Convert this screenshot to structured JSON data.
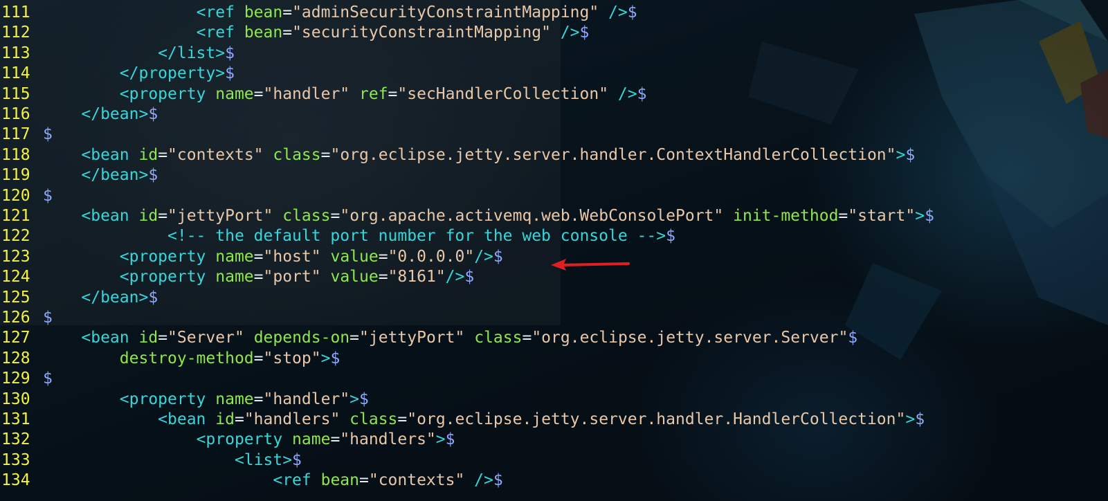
{
  "theme": {
    "line_number_color": "#f4f43a",
    "tag_color": "#36d7d9",
    "attribute_color": "#8ee84c",
    "string_color": "#e8c8a8",
    "eol_marker_color": "#8fa8ff",
    "annotation_arrow_color": "#e02020"
  },
  "annotation": {
    "icon": "red-arrow-icon",
    "points_to_line": "123"
  },
  "lines": [
    {
      "no": "111",
      "indent": 16,
      "tokens": [
        [
          "tag",
          "<ref "
        ],
        [
          "attr",
          "bean"
        ],
        [
          "eq",
          "="
        ],
        [
          "str",
          "\"adminSecurityConstraintMapping\""
        ],
        [
          "tag",
          " />"
        ],
        [
          "eol",
          "$"
        ]
      ]
    },
    {
      "no": "112",
      "indent": 16,
      "tokens": [
        [
          "tag",
          "<ref "
        ],
        [
          "attr",
          "bean"
        ],
        [
          "eq",
          "="
        ],
        [
          "str",
          "\"securityConstraintMapping\""
        ],
        [
          "tag",
          " />"
        ],
        [
          "eol",
          "$"
        ]
      ]
    },
    {
      "no": "113",
      "indent": 12,
      "tokens": [
        [
          "tag",
          "</list>"
        ],
        [
          "eol",
          "$"
        ]
      ]
    },
    {
      "no": "114",
      "indent": 8,
      "tokens": [
        [
          "tag",
          "</property>"
        ],
        [
          "eol",
          "$"
        ]
      ]
    },
    {
      "no": "115",
      "indent": 8,
      "tokens": [
        [
          "tag",
          "<property "
        ],
        [
          "attr",
          "name"
        ],
        [
          "eq",
          "="
        ],
        [
          "str",
          "\"handler\""
        ],
        [
          "txt",
          " "
        ],
        [
          "attr",
          "ref"
        ],
        [
          "eq",
          "="
        ],
        [
          "str",
          "\"secHandlerCollection\""
        ],
        [
          "tag",
          " />"
        ],
        [
          "eol",
          "$"
        ]
      ]
    },
    {
      "no": "116",
      "indent": 4,
      "tokens": [
        [
          "tag",
          "</bean>"
        ],
        [
          "eol",
          "$"
        ]
      ]
    },
    {
      "no": "117",
      "indent": 0,
      "tokens": [
        [
          "eol",
          "$"
        ]
      ]
    },
    {
      "no": "118",
      "indent": 4,
      "tokens": [
        [
          "tag",
          "<bean "
        ],
        [
          "attr",
          "id"
        ],
        [
          "eq",
          "="
        ],
        [
          "str",
          "\"contexts\""
        ],
        [
          "txt",
          " "
        ],
        [
          "attr",
          "class"
        ],
        [
          "eq",
          "="
        ],
        [
          "str",
          "\"org.eclipse.jetty.server.handler.ContextHandlerCollection\""
        ],
        [
          "tag",
          ">"
        ],
        [
          "eol",
          "$"
        ]
      ]
    },
    {
      "no": "119",
      "indent": 4,
      "tokens": [
        [
          "tag",
          "</bean>"
        ],
        [
          "eol",
          "$"
        ]
      ]
    },
    {
      "no": "120",
      "indent": 0,
      "tokens": [
        [
          "eol",
          "$"
        ]
      ]
    },
    {
      "no": "121",
      "indent": 4,
      "tokens": [
        [
          "tag",
          "<bean "
        ],
        [
          "attr",
          "id"
        ],
        [
          "eq",
          "="
        ],
        [
          "str",
          "\"jettyPort\""
        ],
        [
          "txt",
          " "
        ],
        [
          "attr",
          "class"
        ],
        [
          "eq",
          "="
        ],
        [
          "str",
          "\"org.apache.activemq.web.WebConsolePort\""
        ],
        [
          "txt",
          " "
        ],
        [
          "attr",
          "init-method"
        ],
        [
          "eq",
          "="
        ],
        [
          "str",
          "\"start\""
        ],
        [
          "tag",
          ">"
        ],
        [
          "eol",
          "$"
        ]
      ]
    },
    {
      "no": "122",
      "indent": 13,
      "tokens": [
        [
          "com",
          "<!-- the default port number for the web console -->"
        ],
        [
          "eol",
          "$"
        ]
      ]
    },
    {
      "no": "123",
      "indent": 8,
      "tokens": [
        [
          "tag",
          "<property "
        ],
        [
          "attr",
          "name"
        ],
        [
          "eq",
          "="
        ],
        [
          "str",
          "\"host\""
        ],
        [
          "txt",
          " "
        ],
        [
          "attr",
          "value"
        ],
        [
          "eq",
          "="
        ],
        [
          "str",
          "\"0.0.0.0\""
        ],
        [
          "tag",
          "/>"
        ],
        [
          "eol",
          "$"
        ]
      ]
    },
    {
      "no": "124",
      "indent": 8,
      "tokens": [
        [
          "tag",
          "<property "
        ],
        [
          "attr",
          "name"
        ],
        [
          "eq",
          "="
        ],
        [
          "str",
          "\"port\""
        ],
        [
          "txt",
          " "
        ],
        [
          "attr",
          "value"
        ],
        [
          "eq",
          "="
        ],
        [
          "str",
          "\"8161\""
        ],
        [
          "tag",
          "/>"
        ],
        [
          "eol",
          "$"
        ]
      ]
    },
    {
      "no": "125",
      "indent": 4,
      "tokens": [
        [
          "tag",
          "</bean>"
        ],
        [
          "eol",
          "$"
        ]
      ]
    },
    {
      "no": "126",
      "indent": 0,
      "tokens": [
        [
          "eol",
          "$"
        ]
      ]
    },
    {
      "no": "127",
      "indent": 4,
      "tokens": [
        [
          "tag",
          "<bean "
        ],
        [
          "attr",
          "id"
        ],
        [
          "eq",
          "="
        ],
        [
          "str",
          "\"Server\""
        ],
        [
          "txt",
          " "
        ],
        [
          "attr",
          "depends-on"
        ],
        [
          "eq",
          "="
        ],
        [
          "str",
          "\"jettyPort\""
        ],
        [
          "txt",
          " "
        ],
        [
          "attr",
          "class"
        ],
        [
          "eq",
          "="
        ],
        [
          "str",
          "\"org.eclipse.jetty.server.Server\""
        ],
        [
          "eol",
          "$"
        ]
      ]
    },
    {
      "no": "128",
      "indent": 8,
      "tokens": [
        [
          "attr",
          "destroy-method"
        ],
        [
          "eq",
          "="
        ],
        [
          "str",
          "\"stop\""
        ],
        [
          "tag",
          ">"
        ],
        [
          "eol",
          "$"
        ]
      ]
    },
    {
      "no": "129",
      "indent": 0,
      "tokens": [
        [
          "eol",
          "$"
        ]
      ]
    },
    {
      "no": "130",
      "indent": 8,
      "tokens": [
        [
          "tag",
          "<property "
        ],
        [
          "attr",
          "name"
        ],
        [
          "eq",
          "="
        ],
        [
          "str",
          "\"handler\""
        ],
        [
          "tag",
          ">"
        ],
        [
          "eol",
          "$"
        ]
      ]
    },
    {
      "no": "131",
      "indent": 12,
      "tokens": [
        [
          "tag",
          "<bean "
        ],
        [
          "attr",
          "id"
        ],
        [
          "eq",
          "="
        ],
        [
          "str",
          "\"handlers\""
        ],
        [
          "txt",
          " "
        ],
        [
          "attr",
          "class"
        ],
        [
          "eq",
          "="
        ],
        [
          "str",
          "\"org.eclipse.jetty.server.handler.HandlerCollection\""
        ],
        [
          "tag",
          ">"
        ],
        [
          "eol",
          "$"
        ]
      ]
    },
    {
      "no": "132",
      "indent": 16,
      "tokens": [
        [
          "tag",
          "<property "
        ],
        [
          "attr",
          "name"
        ],
        [
          "eq",
          "="
        ],
        [
          "str",
          "\"handlers\""
        ],
        [
          "tag",
          ">"
        ],
        [
          "eol",
          "$"
        ]
      ]
    },
    {
      "no": "133",
      "indent": 20,
      "tokens": [
        [
          "tag",
          "<list>"
        ],
        [
          "eol",
          "$"
        ]
      ]
    },
    {
      "no": "134",
      "indent": 24,
      "tokens": [
        [
          "tag",
          "<ref "
        ],
        [
          "attr",
          "bean"
        ],
        [
          "eq",
          "="
        ],
        [
          "str",
          "\"contexts\""
        ],
        [
          "tag",
          " />"
        ],
        [
          "eol",
          "$"
        ]
      ]
    }
  ]
}
